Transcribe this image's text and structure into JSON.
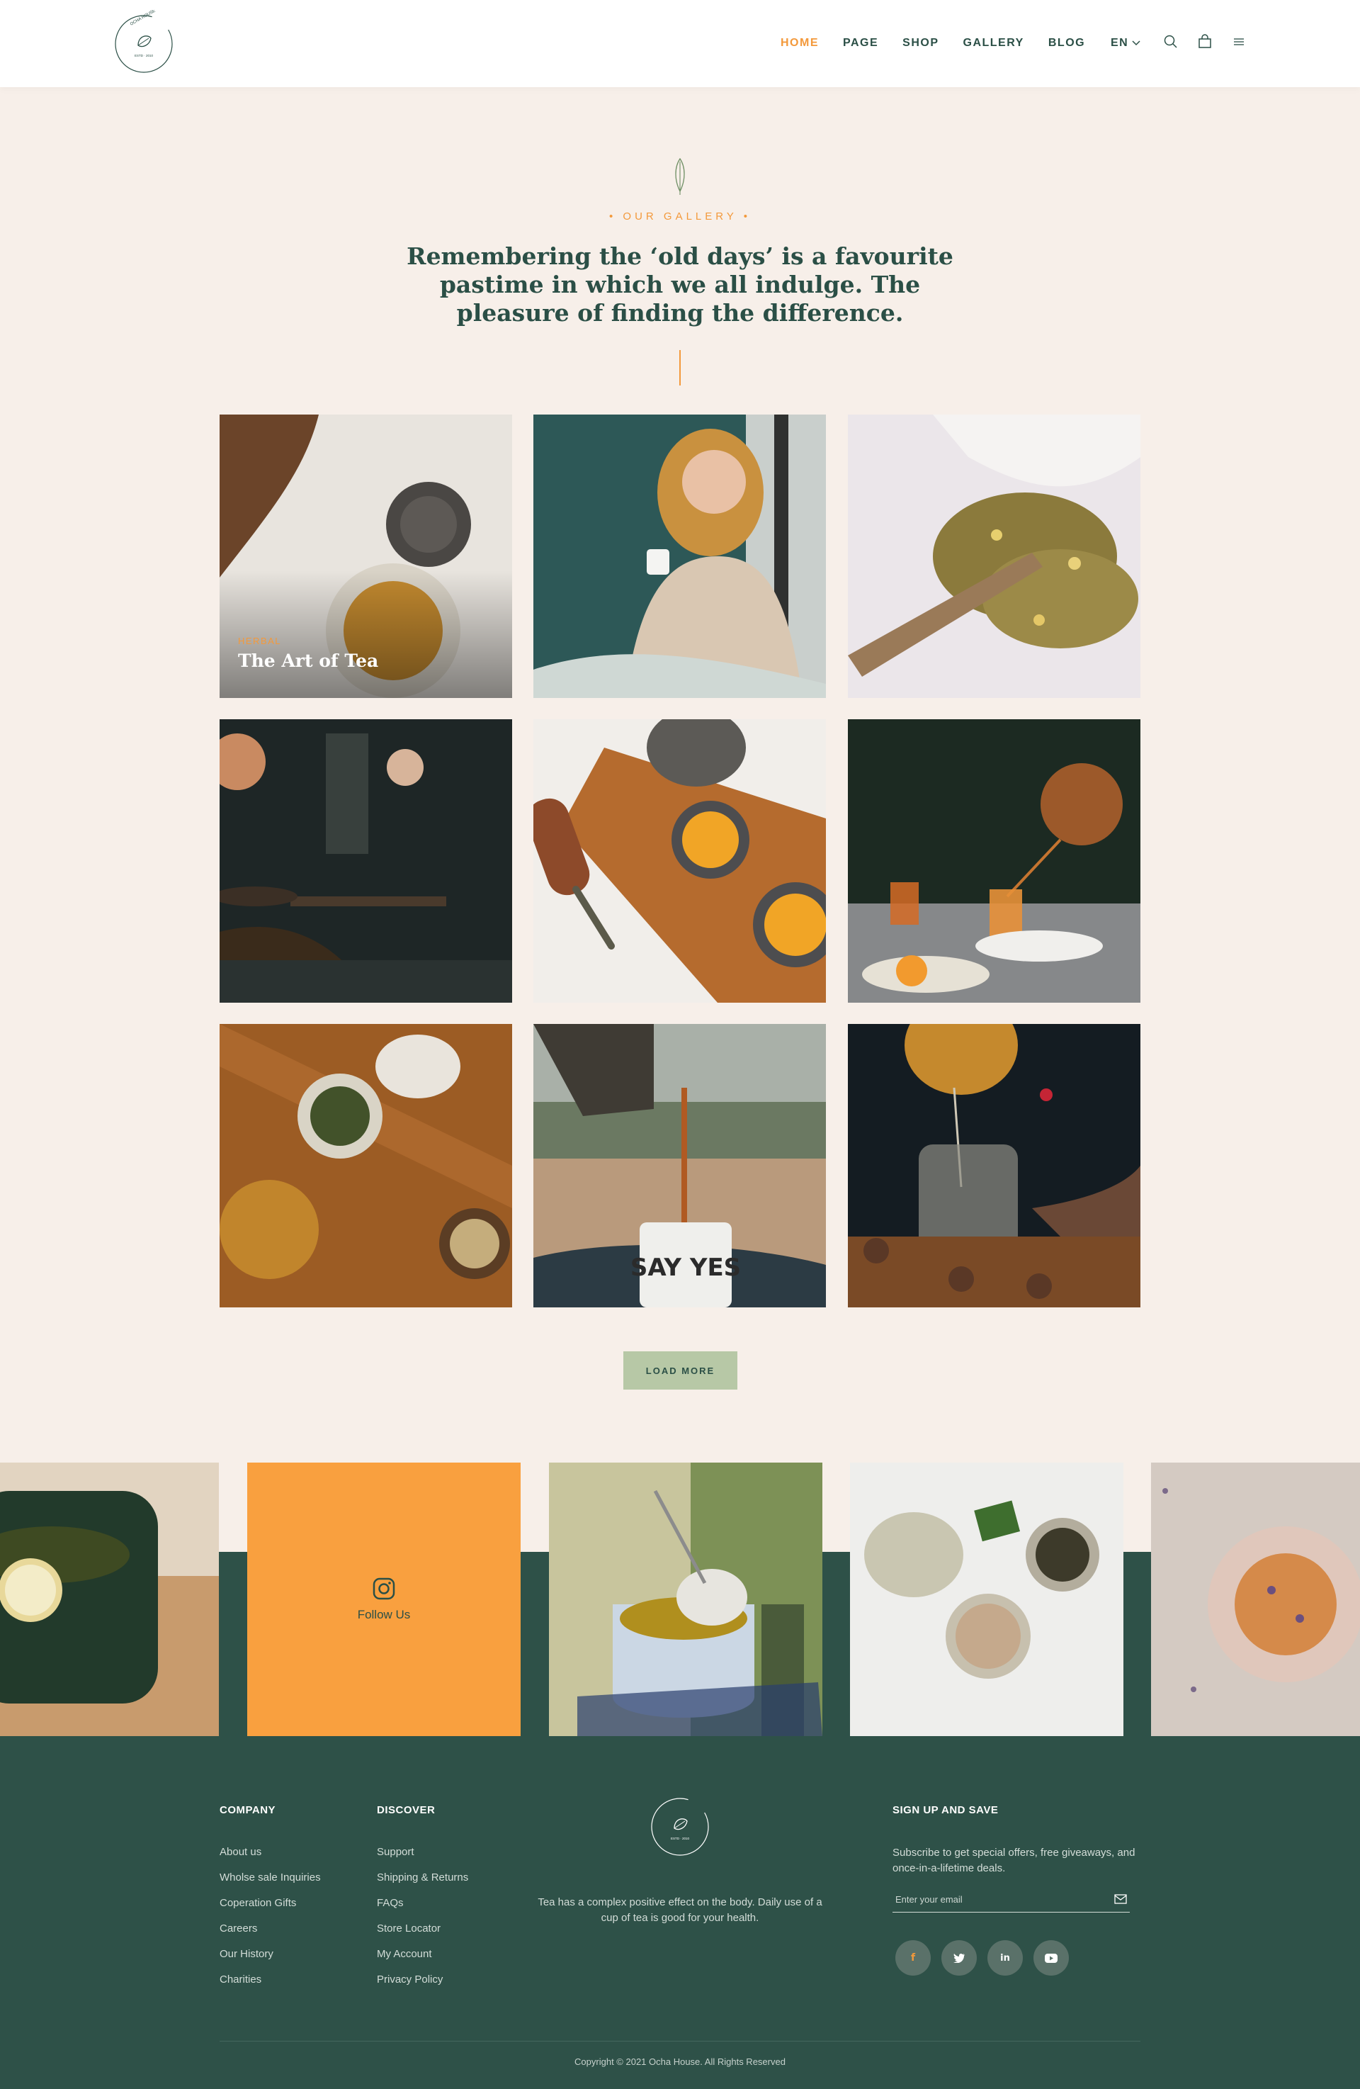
{
  "header": {
    "nav": [
      "HOME",
      "PAGE",
      "SHOP",
      "GALLERY",
      "BLOG"
    ],
    "active_nav": "HOME",
    "lang": "EN",
    "logo_text": "OCHA HOUSE - ORGANIC TEA STORE",
    "logo_year": "ESTD · 2010"
  },
  "gallery": {
    "eyebrow": "• OUR GALLERY •",
    "heading": "Remembering the ‘old days’ is a favourite pastime in which we all indulge. The pleasure of finding the difference.",
    "featured": {
      "category": "HERBAL",
      "title": "The Art of Tea"
    },
    "load_more": "LOAD MORE"
  },
  "instagram": {
    "follow_label": "Follow Us"
  },
  "footer": {
    "company": {
      "heading": "COMPANY",
      "links": [
        "About us",
        "Wholse sale Inquiries",
        "Coperation Gifts",
        "Careers",
        "Our History",
        "Charities"
      ]
    },
    "discover": {
      "heading": "DISCOVER",
      "links": [
        "Support",
        "Shipping & Returns",
        "FAQs",
        "Store Locator",
        "My Account",
        "Privacy Policy"
      ]
    },
    "about_text": "Tea has a complex positive effect on the body. Daily use of a cup of tea is good for your health.",
    "signup": {
      "heading": "SIGN UP AND SAVE",
      "text": "Subscribe to get special offers, free giveaways, and once-in-a-lifetime deals.",
      "placeholder": "Enter your email"
    },
    "social": [
      "f",
      "t",
      "in",
      "yt"
    ],
    "copyright": "Copyright © 2021 Ocha House. All Rights Reserved"
  },
  "colors": {
    "accent": "#f3993b",
    "dark_green": "#2e5148",
    "cream": "#f7efe9",
    "sage": "#b7c8a6"
  }
}
